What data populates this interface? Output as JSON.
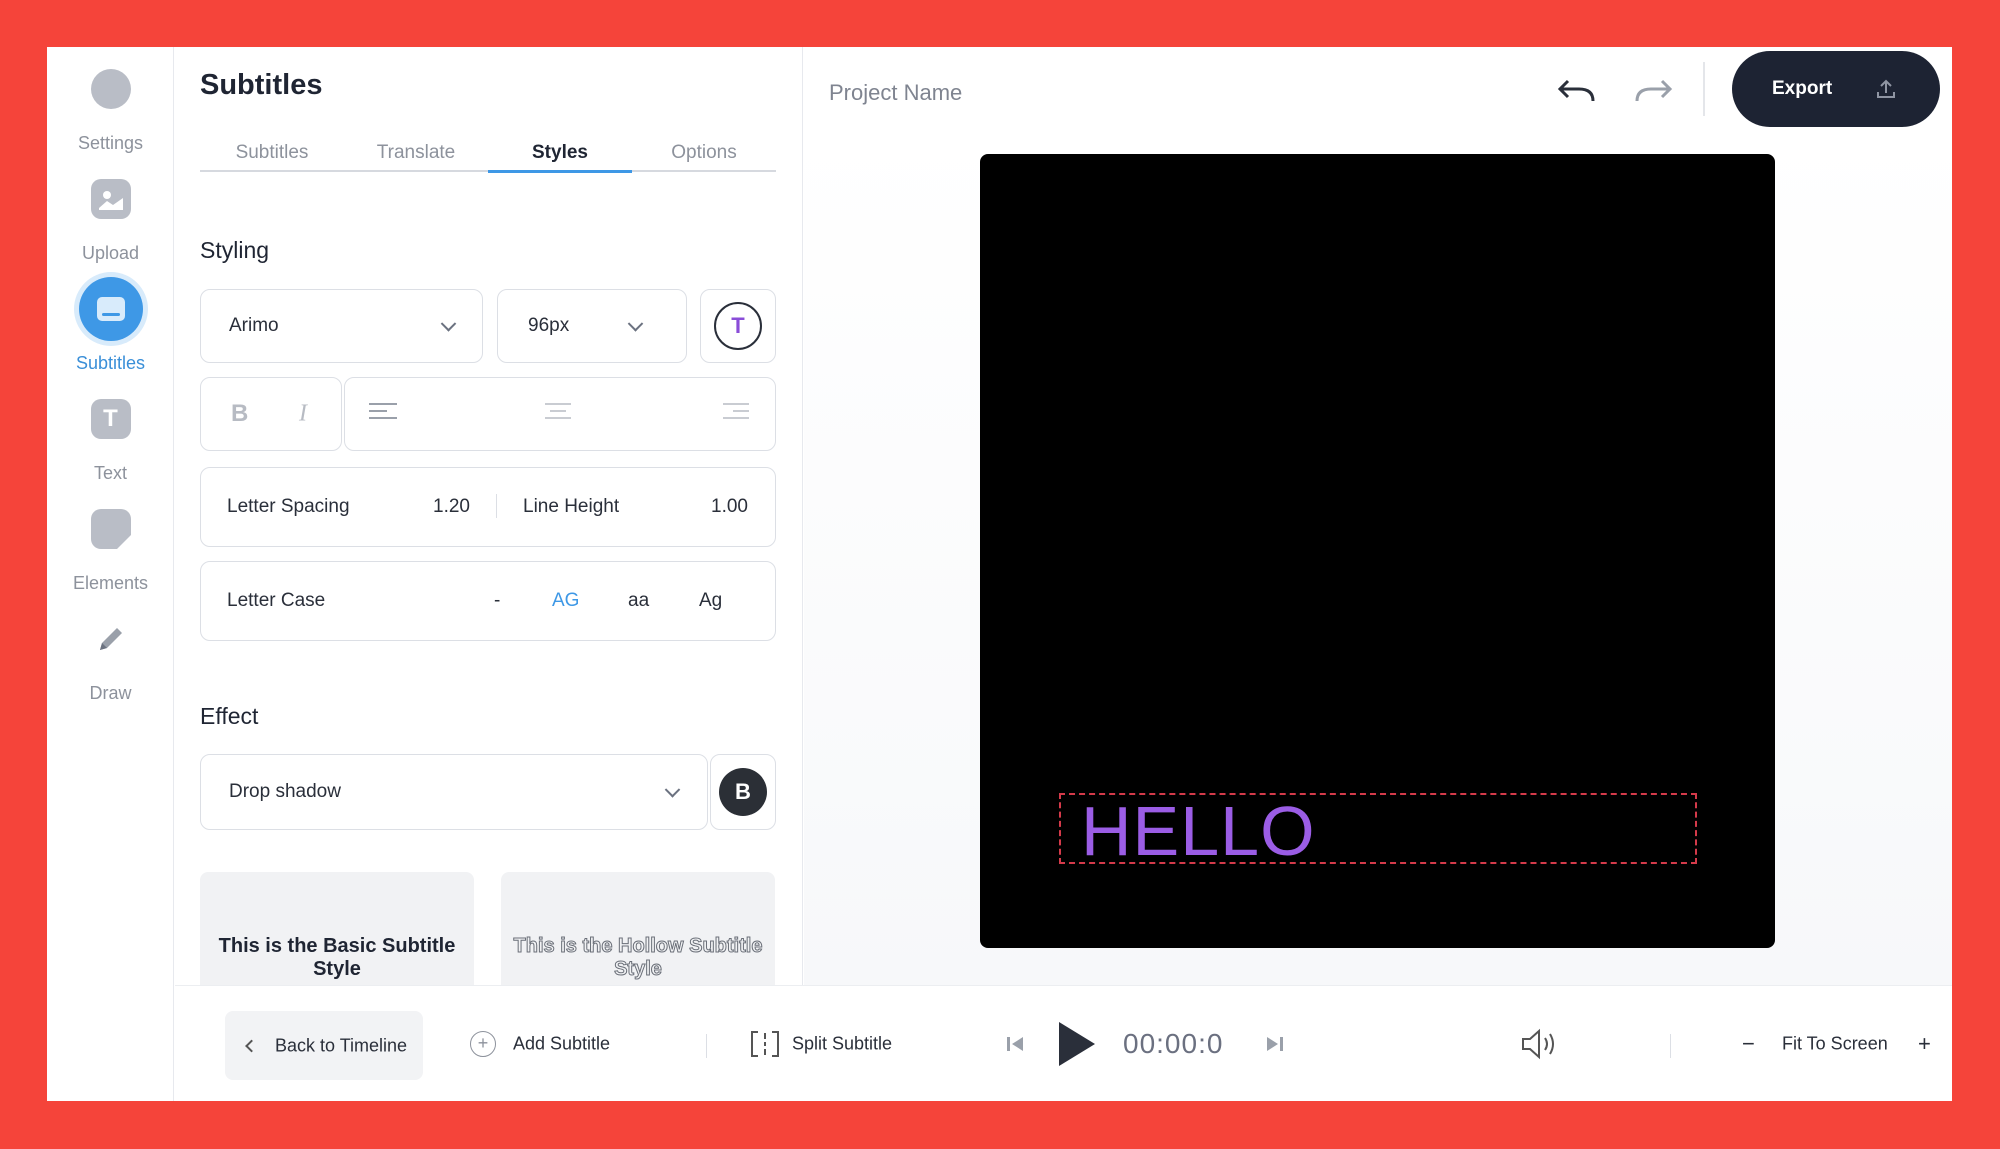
{
  "rail": {
    "items": [
      {
        "label": "Settings",
        "icon": "settings-icon"
      },
      {
        "label": "Upload",
        "icon": "upload-icon"
      },
      {
        "label": "Subtitles",
        "icon": "subtitles-icon",
        "active": true
      },
      {
        "label": "Text",
        "icon": "text-icon"
      },
      {
        "label": "Elements",
        "icon": "elements-icon"
      },
      {
        "label": "Draw",
        "icon": "pencil-icon"
      }
    ]
  },
  "panel": {
    "title": "Subtitles",
    "tabs": [
      "Subtitles",
      "Translate",
      "Styles",
      "Options"
    ],
    "active_tab": "Styles",
    "styling": {
      "heading": "Styling",
      "font": "Arimo",
      "size": "96px",
      "color_button": "T",
      "bold": "B",
      "italic": "I",
      "letter_spacing_label": "Letter Spacing",
      "letter_spacing_value": "1.20",
      "line_height_label": "Line Height",
      "line_height_value": "1.00",
      "letter_case_label": "Letter Case",
      "case_options": [
        "-",
        "AG",
        "aa",
        "Ag"
      ],
      "active_case": "AG"
    },
    "effect": {
      "heading": "Effect",
      "value": "Drop shadow",
      "button": "B"
    },
    "presets": [
      "This is the Basic Subtitle Style",
      "This is the Hollow Subtitle Style"
    ]
  },
  "topbar": {
    "project_name": "Project Name",
    "export_label": "Export"
  },
  "canvas": {
    "text": "HELLO",
    "text_color": "#9b5de5"
  },
  "bottom": {
    "back": "Back to Timeline",
    "add": "Add Subtitle",
    "split": "Split Subtitle",
    "time": "00:00:0",
    "fit": "Fit To Screen",
    "zoom_out": "−",
    "zoom_in": "+"
  },
  "colors": {
    "frame": "#f5443a",
    "accent": "#3e98e6",
    "dark": "#1d2333"
  }
}
